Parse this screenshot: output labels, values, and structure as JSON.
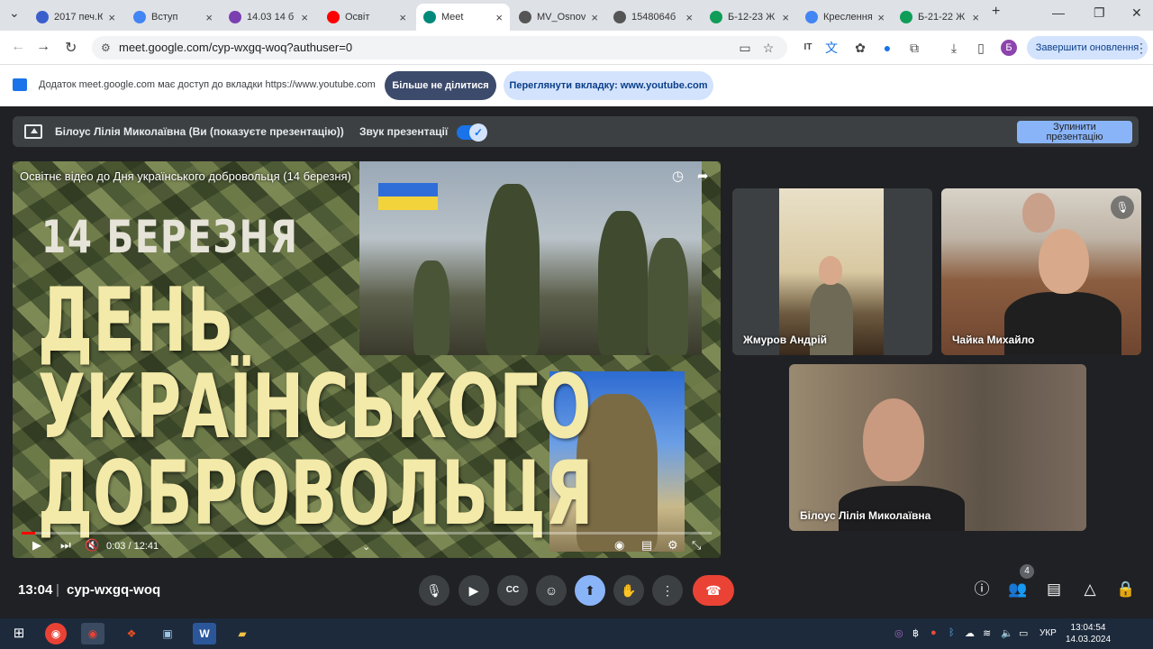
{
  "browser": {
    "tabs": [
      {
        "title": "2017 печ.Ю",
        "color": "#3a5fcd",
        "active": false
      },
      {
        "title": "Вступ",
        "color": "#4285f4",
        "active": false
      },
      {
        "title": "14.03 14 б",
        "color": "#7b3fb0",
        "active": false
      },
      {
        "title": "Освіт",
        "color": "#ff0000",
        "active": false
      },
      {
        "title": "Meet",
        "color": "#00897b",
        "active": true
      },
      {
        "title": "MV_Osnov",
        "color": "#555555",
        "active": false
      },
      {
        "title": "1548064б",
        "color": "#555555",
        "active": false
      },
      {
        "title": "Б-12-23 Ж",
        "color": "#0f9d58",
        "active": false
      },
      {
        "title": "Креслення",
        "color": "#4285f4",
        "active": false
      },
      {
        "title": "Б-21-22 Ж",
        "color": "#0f9d58",
        "active": false
      }
    ],
    "new_tab": "+",
    "url": "meet.google.com/cyp-wxgq-woq?authuser=0",
    "update_button": "Завершити оновлення",
    "profile_initial": "Б"
  },
  "share_notice": {
    "message": "Додаток meet.google.com має доступ до вкладки https://www.youtube.com",
    "stop_sharing": "Більше не ділитися",
    "view_tab": "Переглянути вкладку: www.youtube.com"
  },
  "presenting_bar": {
    "presenter_text": "Білоус Лілія Миколаївна (Ви (показуєте презентацію))",
    "sound_label": "Звук презентації",
    "sound_on": true,
    "stop_button_line1": "Зупинити",
    "stop_button_line2": "презентацію"
  },
  "video": {
    "title": "Освітнє відео до Дня українського добровольця (14 березня)",
    "date_text": "14 БЕРЕЗНЯ",
    "line1": "ДЕНЬ",
    "line2": "УКРАЇНСЬКОГО",
    "line3": "ДОБРОВОЛЬЦЯ",
    "time": "0:03 / 12:41",
    "progress": 0.004
  },
  "participants": [
    {
      "name": "Жмуров Андрій",
      "muted": false
    },
    {
      "name": "Чайка Михайло",
      "muted": true
    },
    {
      "name": "Білоус Лілія Миколаївна",
      "muted": false
    }
  ],
  "meeting": {
    "clock": "13:04",
    "separator": "|",
    "code": "cyp-wxgq-woq",
    "people_count": "4"
  },
  "taskbar": {
    "language": "УКР",
    "time": "13:04:54",
    "date": "14.03.2024"
  }
}
